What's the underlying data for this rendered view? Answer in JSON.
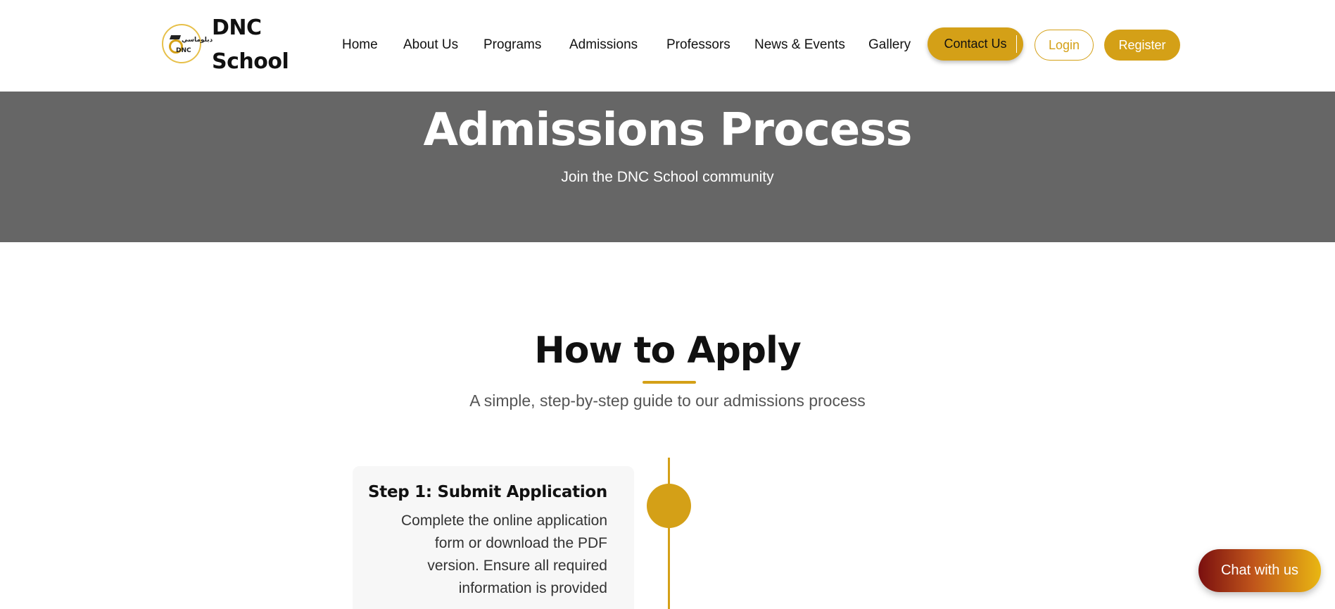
{
  "brand": {
    "logo_text_top": "دبلوماسي",
    "logo_text_bottom": "DNC",
    "name_line1": "DNC",
    "name_line2": "School"
  },
  "nav": {
    "items": [
      "Home",
      "About Us",
      "Programs",
      "Admissions",
      "Professors",
      "News & Events",
      "Gallery"
    ]
  },
  "actions": {
    "contact": "Contact Us",
    "login": "Login",
    "register": "Register"
  },
  "hero": {
    "title": "Admissions Process",
    "subtitle": "Join the DNC School community"
  },
  "how_to_apply": {
    "title": "How to Apply",
    "subtitle": "A simple, step-by-step guide to our admissions process",
    "steps": [
      {
        "title": "Step 1: Submit Application",
        "desc_lines": [
          "Complete the online application",
          "form or download the PDF",
          "version. Ensure all required",
          "information is provided"
        ]
      }
    ]
  },
  "chat": {
    "label": "Chat with us"
  },
  "colors": {
    "accent": "#d4a017",
    "hero_bg": "#666666"
  }
}
